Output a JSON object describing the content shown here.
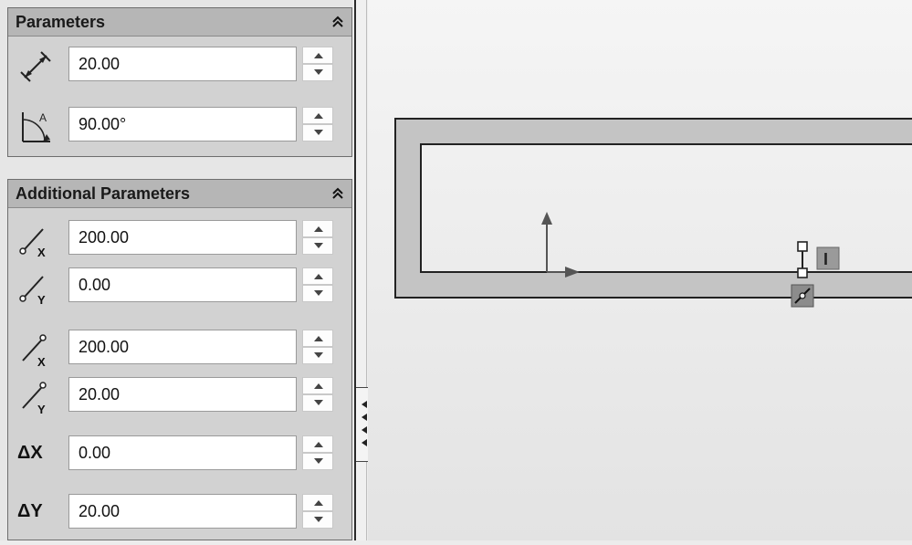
{
  "parameters": {
    "title": "Parameters",
    "collapse_icon": "double-chevron-up-icon",
    "length": {
      "icon": "distance-icon",
      "value": "20.00"
    },
    "angle": {
      "icon": "angle-icon",
      "value": "90.00°"
    }
  },
  "additional_parameters": {
    "title": "Additional Parameters",
    "collapse_icon": "double-chevron-up-icon",
    "start_x": {
      "icon": "start-x-icon",
      "value": "200.00"
    },
    "start_y": {
      "icon": "start-y-icon",
      "value": "0.00"
    },
    "end_x": {
      "icon": "end-x-icon",
      "value": "200.00"
    },
    "end_y": {
      "icon": "end-y-icon",
      "value": "20.00"
    },
    "delta_x": {
      "label": "ΔX",
      "value": "0.00"
    },
    "delta_y": {
      "label": "ΔY",
      "value": "20.00"
    }
  },
  "canvas": {
    "inline_label": "I"
  },
  "colors": {
    "panel_bg": "#d2d2d2",
    "header_bg": "#b6b6b6",
    "part_fill": "#c4c4c4",
    "canvas_bg": "#ececec"
  }
}
